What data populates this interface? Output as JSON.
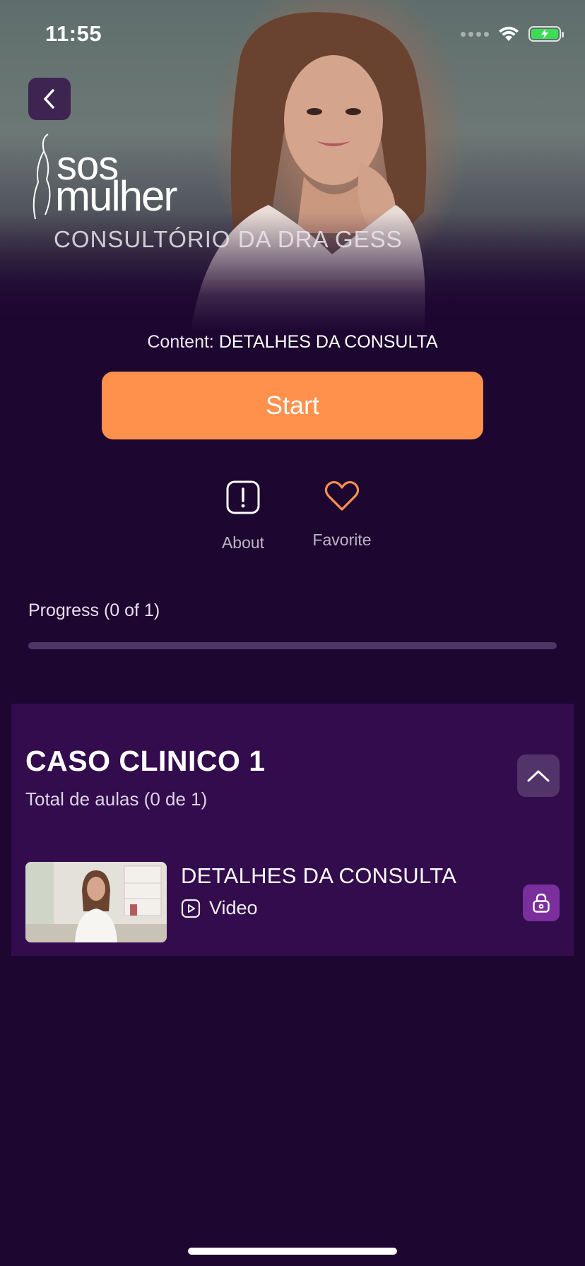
{
  "status_bar": {
    "time": "11:55"
  },
  "hero": {
    "logo_line1": "SOS",
    "logo_line2": "mulher",
    "logo_subtitle": "CONSULTÓRIO DA DRA GESS"
  },
  "content": {
    "label_prefix": "Content:",
    "label_value": "DETALHES DA CONSULTA",
    "start_label": "Start"
  },
  "actions": {
    "about_label": "About",
    "favorite_label": "Favorite"
  },
  "progress": {
    "label": "Progress (0 of 1)",
    "completed": 0,
    "total": 1
  },
  "module": {
    "title": "CASO CLINICO 1",
    "subtitle": "Total de aulas (0 de 1)",
    "lessons": [
      {
        "title": "DETALHES DA CONSULTA",
        "type": "Video",
        "locked": true
      }
    ]
  },
  "colors": {
    "background": "#1d0630",
    "accent": "#ff914d",
    "card": "#330c4d",
    "lock": "#7a2f9c"
  }
}
